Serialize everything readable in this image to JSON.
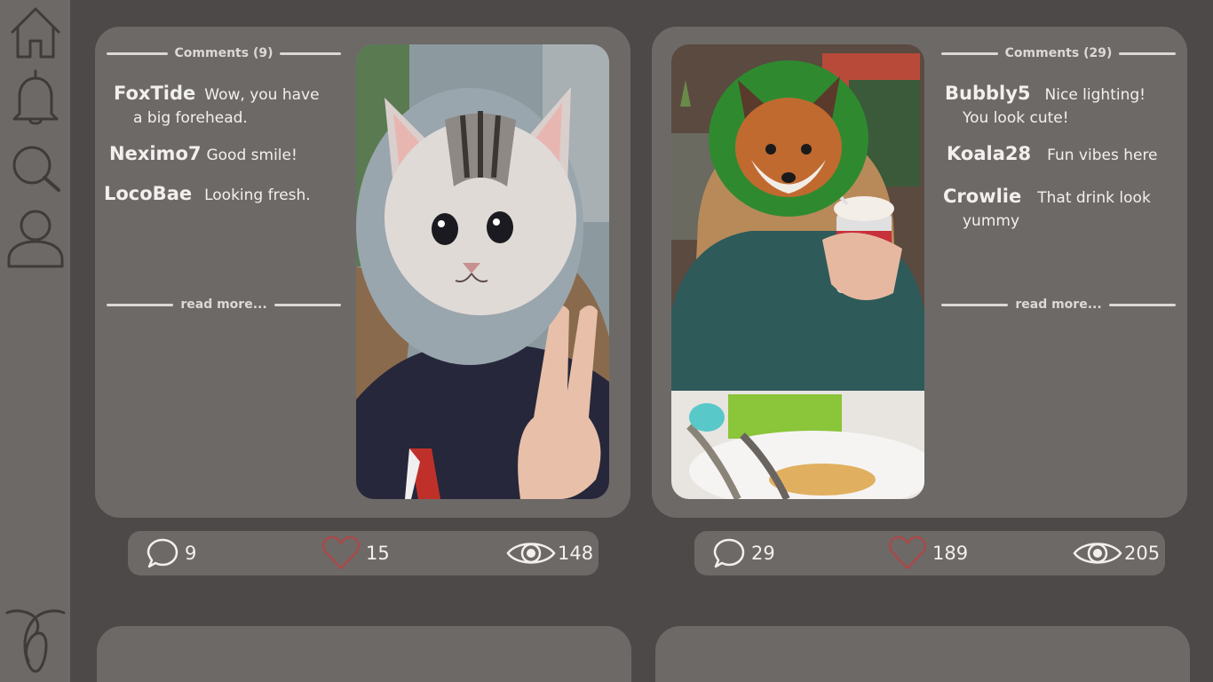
{
  "sidebar": {
    "items": [
      {
        "icon": "home-icon"
      },
      {
        "icon": "bell-icon"
      },
      {
        "icon": "search-icon"
      },
      {
        "icon": "user-icon"
      }
    ],
    "logo_icon": "logo-icon"
  },
  "posts": [
    {
      "comments_header": "Comments (9)",
      "comments": [
        {
          "user": "FoxTide",
          "text": "Wow, you have",
          "cont": "a big forehead."
        },
        {
          "user": "Neximo7",
          "text": "Good smile!",
          "cont": ""
        },
        {
          "user": "LocoBae",
          "text": "Looking fresh.",
          "cont": ""
        }
      ],
      "read_more": "read more...",
      "photo_icon": "cat-face-photo",
      "stats": {
        "comments": "9",
        "likes": "15",
        "views": "148"
      }
    },
    {
      "comments_header": "Comments (29)",
      "comments": [
        {
          "user": "Bubbly5",
          "text": "Nice lighting!",
          "cont": "You look cute!"
        },
        {
          "user": "Koala28",
          "text": "Fun vibes here",
          "cont": ""
        },
        {
          "user": "Crowlie",
          "text": "That drink look",
          "cont": "yummy"
        }
      ],
      "read_more": "read more...",
      "photo_icon": "fox-face-photo",
      "stats": {
        "comments": "29",
        "likes": "189",
        "views": "205"
      }
    }
  ],
  "colors": {
    "background": "#4d4948",
    "panel": "#6d6967",
    "text": "#f2f0ee",
    "heart": "#a84a4a"
  }
}
